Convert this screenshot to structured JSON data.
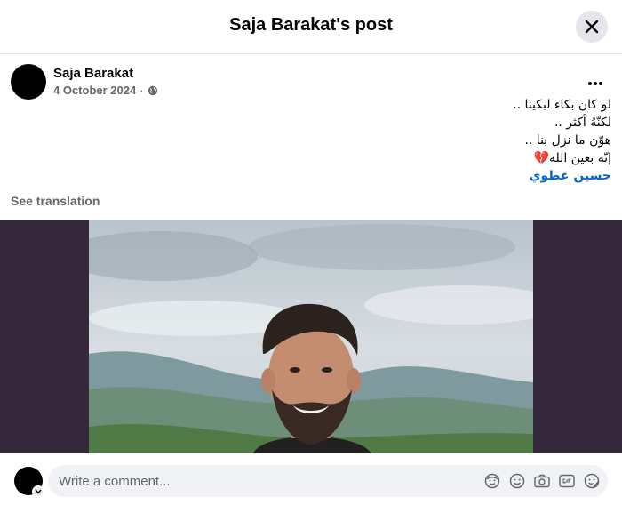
{
  "header": {
    "title": "Saja Barakat's post",
    "close_icon": "close-icon"
  },
  "post": {
    "author": "Saja Barakat",
    "date": "4 October 2024",
    "separator": "·",
    "audience_icon": "globe-icon",
    "more_icon": "more-horizontal-icon",
    "text_lines": [
      "لو كان بكاء لبكينا ..",
      "لكنّهُ أكثر ..",
      "هوّن ما نزل بنا ..",
      "إنّه بعين الله💔"
    ],
    "hashtag": "حسين عطوي",
    "see_translation": "See translation",
    "photo_background": "#35283a"
  },
  "comment": {
    "placeholder": "Write a comment...",
    "icons": [
      "avatar-sticker-icon",
      "emoji-icon",
      "camera-icon",
      "gif-icon",
      "sticker-icon"
    ]
  },
  "colors": {
    "accent": "#0064d1",
    "secondary_text": "#65676b",
    "surface": "#f0f2f5"
  }
}
